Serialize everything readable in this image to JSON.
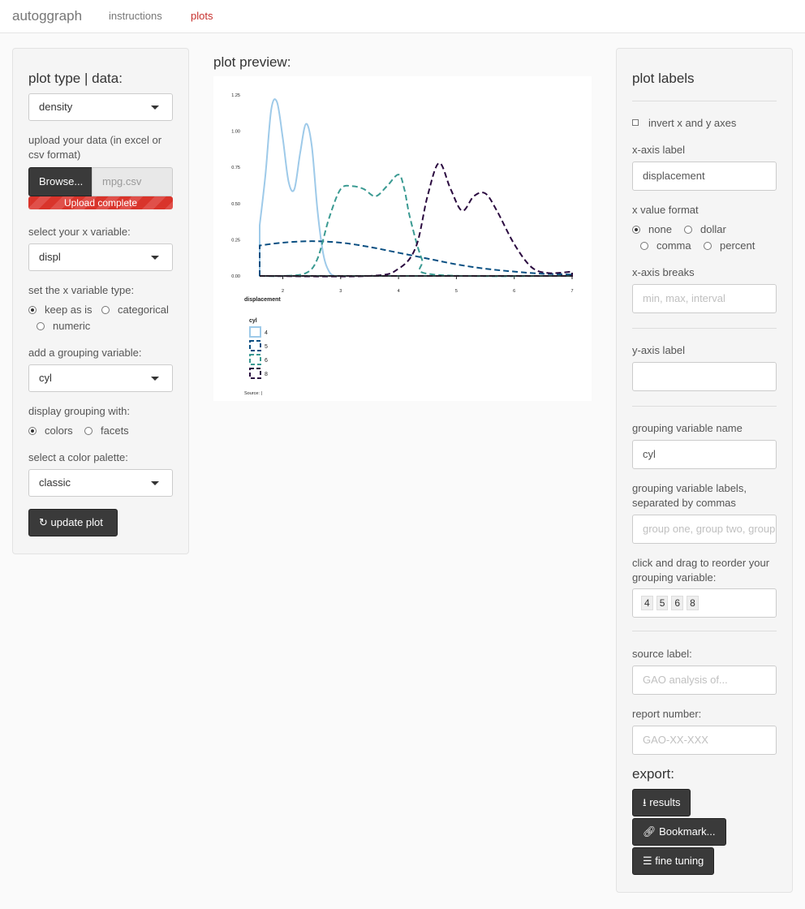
{
  "nav": {
    "brand": "autoggraph",
    "tabs": [
      "instructions",
      "plots"
    ],
    "active_tab": "plots"
  },
  "left": {
    "title": "plot type | data:",
    "plot_type": "density",
    "upload_label": "upload your data (in excel or csv format)",
    "browse_label": "Browse...",
    "file_name": "mpg.csv",
    "upload_status": "Upload complete",
    "x_var_label": "select your x variable:",
    "x_var": "displ",
    "x_type_label": "set the x variable type:",
    "x_type_options": [
      "keep as is",
      "categorical",
      "numeric"
    ],
    "x_type_selected": "keep as is",
    "group_label": "add a grouping variable:",
    "group_var": "cyl",
    "display_label": "display grouping with:",
    "display_options": [
      "colors",
      "facets"
    ],
    "display_selected": "colors",
    "palette_label": "select a color palette:",
    "palette": "classic",
    "update_button": "update plot"
  },
  "center": {
    "title": "plot preview:"
  },
  "right": {
    "title": "plot labels",
    "invert_label": "invert x and y axes",
    "x_axis_label_title": "x-axis label",
    "x_axis_label_value": "displacement",
    "x_format_title": "x value format",
    "x_format_options": [
      "none",
      "dollar",
      "comma",
      "percent"
    ],
    "x_format_selected": "none",
    "x_breaks_title": "x-axis breaks",
    "x_breaks_placeholder": "min, max, interval",
    "y_axis_label_title": "y-axis label",
    "y_axis_label_value": "",
    "group_name_title": "grouping variable name",
    "group_name_value": "cyl",
    "group_labels_title": "grouping variable labels, separated by commas",
    "group_labels_placeholder": "group one, group two, group three",
    "reorder_title": "click and drag to reorder your grouping variable:",
    "reorder_items": [
      "4",
      "5",
      "6",
      "8"
    ],
    "source_title": "source label:",
    "source_placeholder": "GAO analysis of...",
    "report_title": "report number:",
    "report_placeholder": "GAO-XX-XXX",
    "export_title": "export:",
    "results_button": "results",
    "bookmark_button": "Bookmark...",
    "fine_tuning_button": "fine tuning"
  },
  "colors": {
    "accent": "#c7302d",
    "cyl4": "#9ecae9",
    "cyl5": "#0a4f82",
    "cyl6": "#3a9a92",
    "cyl8": "#2a0a3f"
  },
  "chart_data": {
    "type": "line",
    "xlabel": "displacement",
    "ylabel": "",
    "xlim": [
      1.6,
      7.0
    ],
    "ylim": [
      0,
      1.25
    ],
    "x_ticks": [
      "2",
      "3",
      "4",
      "5",
      "6",
      "7"
    ],
    "y_ticks": [
      "0.00",
      "0.25",
      "0.50",
      "0.75",
      "1.00",
      "1.25"
    ],
    "legend_title": "cyl",
    "legend_position": "bottom-left",
    "source_text": "Source:  |",
    "series": [
      {
        "name": "4",
        "color": "#9ecae9",
        "dash": "solid",
        "x": [
          1.6,
          1.7,
          1.8,
          1.9,
          2.0,
          2.1,
          2.2,
          2.3,
          2.4,
          2.5,
          2.6,
          2.7,
          2.8,
          2.9,
          3.0,
          3.1,
          3.2,
          7.0
        ],
        "y": [
          0.35,
          0.7,
          1.15,
          1.2,
          0.95,
          0.65,
          0.6,
          0.85,
          1.05,
          0.9,
          0.45,
          0.15,
          0.03,
          0.0,
          0.0,
          0.0,
          0.0,
          0.0
        ]
      },
      {
        "name": "5",
        "color": "#0a4f82",
        "dash": "dash",
        "x": [
          1.6,
          2.0,
          2.5,
          3.0,
          3.5,
          4.0,
          4.5,
          5.0,
          5.5,
          6.0,
          6.5,
          7.0
        ],
        "y": [
          0.21,
          0.23,
          0.24,
          0.23,
          0.2,
          0.16,
          0.12,
          0.08,
          0.05,
          0.03,
          0.015,
          0.01
        ]
      },
      {
        "name": "6",
        "color": "#3a9a92",
        "dash": "dash",
        "x": [
          1.6,
          2.0,
          2.4,
          2.6,
          2.8,
          3.0,
          3.2,
          3.4,
          3.6,
          3.8,
          4.0,
          4.1,
          4.2,
          4.4,
          4.6,
          7.0
        ],
        "y": [
          0.0,
          0.0,
          0.02,
          0.12,
          0.4,
          0.6,
          0.62,
          0.6,
          0.55,
          0.62,
          0.7,
          0.6,
          0.4,
          0.12,
          0.01,
          0.0
        ],
        "draw": "area"
      },
      {
        "name": "8",
        "color": "#2a0a3f",
        "dash": "dash",
        "x": [
          1.6,
          3.5,
          4.0,
          4.3,
          4.5,
          4.7,
          4.9,
          5.1,
          5.3,
          5.5,
          5.7,
          6.0,
          6.3,
          6.6,
          7.0
        ],
        "y": [
          0.0,
          0.0,
          0.05,
          0.2,
          0.55,
          0.78,
          0.6,
          0.45,
          0.55,
          0.57,
          0.45,
          0.22,
          0.06,
          0.02,
          0.03
        ]
      }
    ]
  }
}
